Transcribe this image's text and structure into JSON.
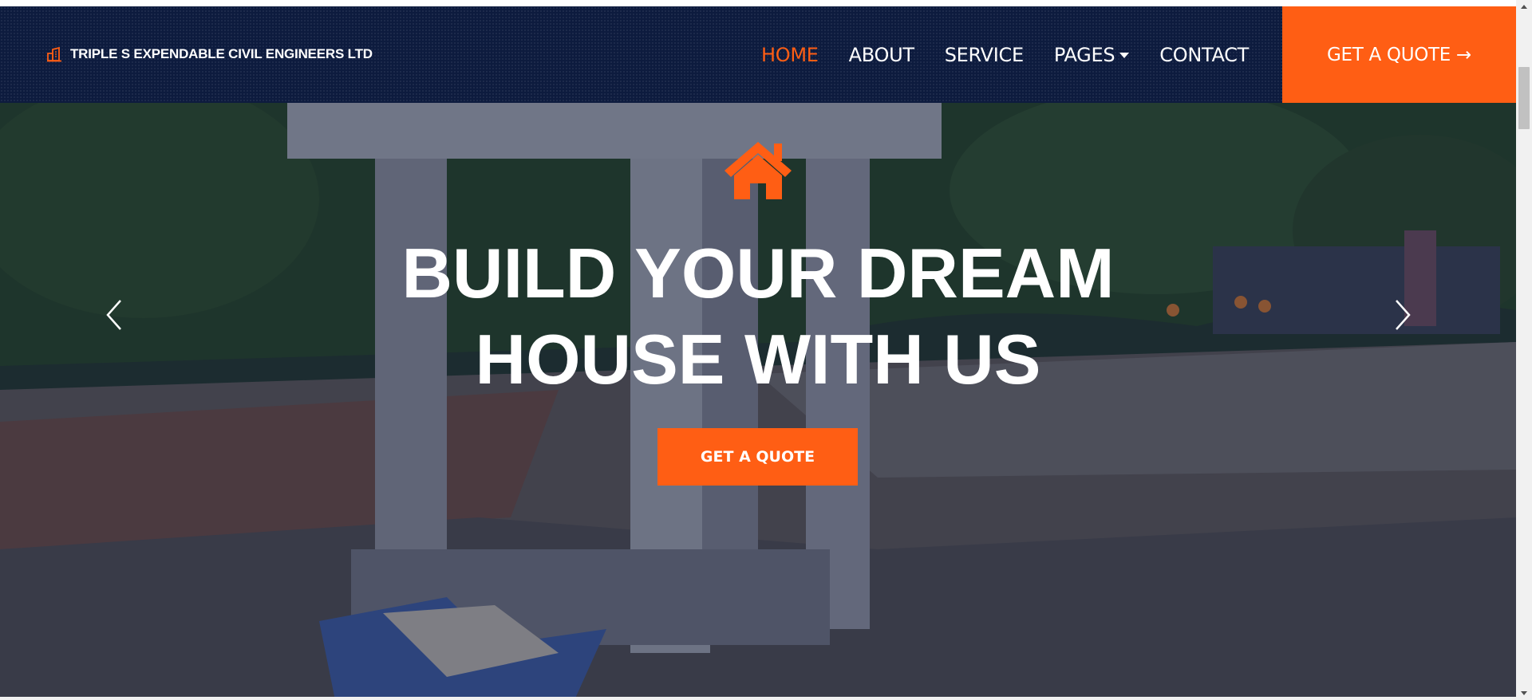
{
  "brand": {
    "name": "TRIPLE S EXPENDABLE CIVIL ENGINEERS LTD",
    "icon": "building-icon"
  },
  "nav": {
    "items": [
      {
        "label": "HOME",
        "active": true
      },
      {
        "label": "ABOUT",
        "active": false
      },
      {
        "label": "SERVICE",
        "active": false
      },
      {
        "label": "PAGES",
        "active": false,
        "dropdown": true
      },
      {
        "label": "CONTACT",
        "active": false
      }
    ],
    "quote_button": "GET A QUOTE →"
  },
  "hero": {
    "icon": "house-icon",
    "title_line1": "BUILD YOUR DREAM",
    "title_line2": "HOUSE WITH US",
    "cta": "GET A QUOTE"
  },
  "carousel": {
    "prev_icon": "chevron-left-icon",
    "next_icon": "chevron-right-icon"
  },
  "colors": {
    "accent": "#ff5e14",
    "navbar": "#0d1b3e",
    "text": "#ffffff"
  }
}
